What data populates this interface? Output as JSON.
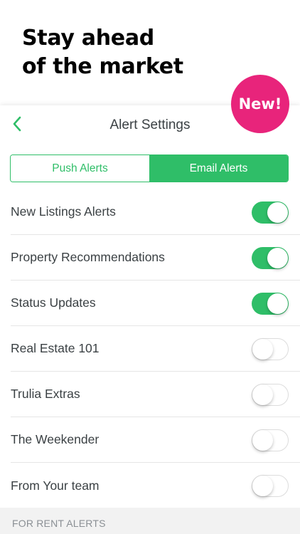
{
  "promo": {
    "headline_line1": "Stay ahead",
    "headline_line2": "of the market",
    "badge": "New!",
    "badge_color": "#e8247b"
  },
  "nav": {
    "back_icon": "chevron-left-icon",
    "title": "Alert Settings"
  },
  "tabs": [
    {
      "label": "Push Alerts",
      "selected": false
    },
    {
      "label": "Email Alerts",
      "selected": true
    }
  ],
  "accent_color": "#2fbe68",
  "alerts": [
    {
      "label": "New Listings Alerts",
      "enabled": true
    },
    {
      "label": "Property Recommendations",
      "enabled": true
    },
    {
      "label": "Status Updates",
      "enabled": true
    },
    {
      "label": "Real Estate 101",
      "enabled": false
    },
    {
      "label": "Trulia Extras",
      "enabled": false
    },
    {
      "label": "The Weekender",
      "enabled": false
    },
    {
      "label": "From Your team",
      "enabled": false
    }
  ],
  "section_header": "FOR RENT ALERTS"
}
